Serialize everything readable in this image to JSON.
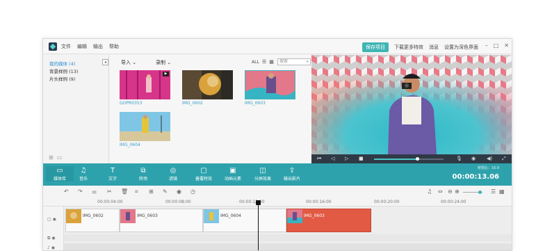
{
  "menu": [
    "文件",
    "编辑",
    "输出",
    "帮助"
  ],
  "top_right": {
    "save": "保存项目",
    "more_effects": "下载更多特效",
    "messages": "消息",
    "dark_mode": "设置为深色界面"
  },
  "sidebar": {
    "items": [
      {
        "label": "我的媒体 (4)",
        "active": true
      },
      {
        "label": "背景样例 (13)",
        "active": false
      },
      {
        "label": "片头样例 (9)",
        "active": false
      }
    ]
  },
  "media_toolbar": {
    "import": "导入",
    "record": "录制",
    "all": "ALL",
    "search_placeholder": "搜索"
  },
  "media": [
    {
      "label": "GOPR0353"
    },
    {
      "label": "IMG_0602"
    },
    {
      "label": "IMG_0603"
    },
    {
      "label": "IMG_0604"
    }
  ],
  "effects": [
    {
      "label": "媒体库",
      "icon": "folder-icon"
    },
    {
      "label": "音乐",
      "icon": "music-icon"
    },
    {
      "label": "文字",
      "icon": "text-icon"
    },
    {
      "label": "转场",
      "icon": "transition-icon"
    },
    {
      "label": "滤镜",
      "icon": "filter-icon"
    },
    {
      "label": "叠覆特效",
      "icon": "overlay-icon"
    },
    {
      "label": "动画元素",
      "icon": "element-icon"
    },
    {
      "label": "分屏效果",
      "icon": "split-icon"
    },
    {
      "label": "输出影片",
      "icon": "export-icon"
    }
  ],
  "time_label": "常规比：16:9",
  "timecode": "00:00:13.06",
  "ruler": [
    "00:00:04:00",
    "00:00:08:00",
    "00:00:12:00",
    "00:00:16:00",
    "00:00:20:00",
    "00:00:24:00"
  ],
  "clips": [
    {
      "label": "IMG_0602"
    },
    {
      "label": "IMG_0603"
    },
    {
      "label": "IMG_0604"
    },
    {
      "label": "IMG_0603"
    }
  ],
  "playback_progress": 0.62
}
